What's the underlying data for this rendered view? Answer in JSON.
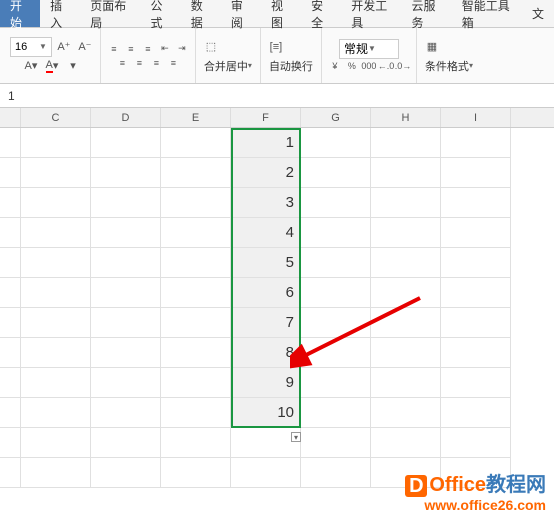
{
  "menu": {
    "tabs": [
      "开始",
      "插入",
      "页面布局",
      "公式",
      "数据",
      "审阅",
      "视图",
      "安全",
      "开发工具",
      "云服务",
      "智能工具箱",
      "文"
    ],
    "active_index": 0
  },
  "ribbon": {
    "font_size": "16",
    "increase_font": "A⁺",
    "decrease_font": "A⁻",
    "merge_center": "合并居中",
    "wrap_text": "自动换行",
    "number_format": "常规",
    "currency": "¥",
    "percent": "%",
    "thousands": "000",
    "dec_inc": ".0→.00",
    "dec_dec": ".00→.0",
    "cond_format": "条件格式"
  },
  "formula_bar": {
    "value": "1"
  },
  "columns": [
    "C",
    "D",
    "E",
    "F",
    "G",
    "H",
    "I"
  ],
  "cells_F": [
    "1",
    "2",
    "3",
    "4",
    "5",
    "6",
    "7",
    "8",
    "9",
    "10"
  ],
  "watermark": {
    "logo_letter": "D",
    "brand1": "Office",
    "brand2": "教程网",
    "url": "www.office26.com"
  }
}
